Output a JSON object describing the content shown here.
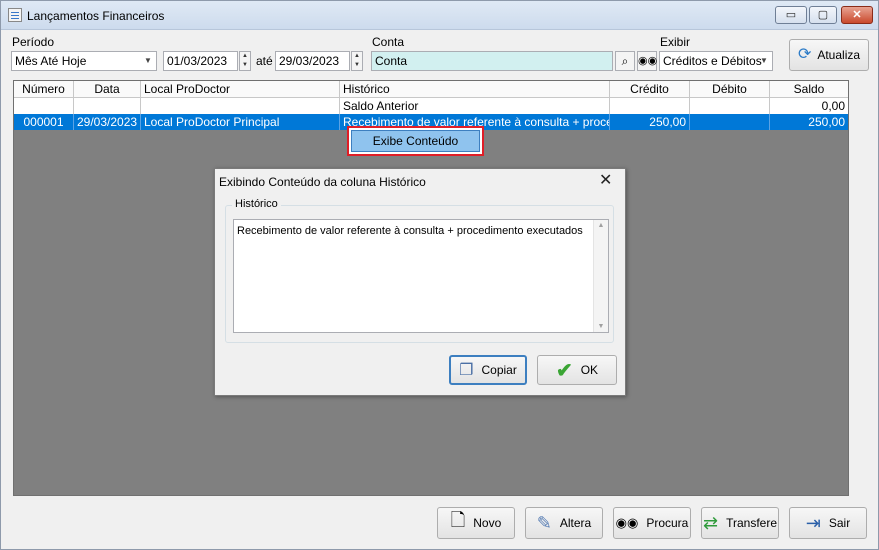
{
  "window": {
    "title": "Lançamentos Financeiros",
    "min": "▭",
    "max": "▢",
    "close": "✕"
  },
  "filters": {
    "periodo_label": "Período",
    "periodo_value": "Mês Até Hoje",
    "date_from": "01/03/2023",
    "ate_label": "até",
    "date_to": "29/03/2023",
    "conta_label": "Conta",
    "conta_value": "Conta",
    "exibir_label": "Exibir",
    "exibir_value": "Créditos e Débitos",
    "atualiza_label": "Atualiza"
  },
  "grid": {
    "columns": [
      "Número",
      "Data",
      "Local ProDoctor",
      "Histórico",
      "Crédito",
      "Débito",
      "Saldo"
    ],
    "rows": [
      {
        "numero": "",
        "data": "",
        "local": "",
        "historico": "Saldo Anterior",
        "credito": "",
        "debito": "",
        "saldo": "0,00"
      },
      {
        "numero": "000001",
        "data": "29/03/2023",
        "local": "Local ProDoctor Principal",
        "historico": "Recebimento de valor referente à consulta + proce...",
        "credito": "250,00",
        "debito": "",
        "saldo": "250,00"
      }
    ]
  },
  "context_button": "Exibe Conteúdo",
  "dialog": {
    "title": "Exibindo Conteúdo da coluna Histórico",
    "close": "✕",
    "group_label": "Histórico",
    "memo_text": "Recebimento de valor referente à consulta + procedimento executados",
    "copiar_label": "Copiar",
    "ok_label": "OK"
  },
  "bottom_buttons": {
    "novo": "Novo",
    "altera": "Altera",
    "procura": "Procura",
    "transfere": "Transfere",
    "sair": "Sair"
  },
  "icons": {
    "search": "search-icon",
    "binoculars": "binoculars-icon",
    "refresh": "refresh-icon",
    "copy": "copy-icon",
    "check": "check-icon",
    "new": "new-document-icon",
    "edit": "edit-icon",
    "find": "find-icon",
    "transfer": "transfer-icon",
    "exit": "exit-icon"
  },
  "colors": {
    "selection": "#0078d7",
    "highlight_border": "#e01e27",
    "conta_bg": "#d2f0f0"
  }
}
